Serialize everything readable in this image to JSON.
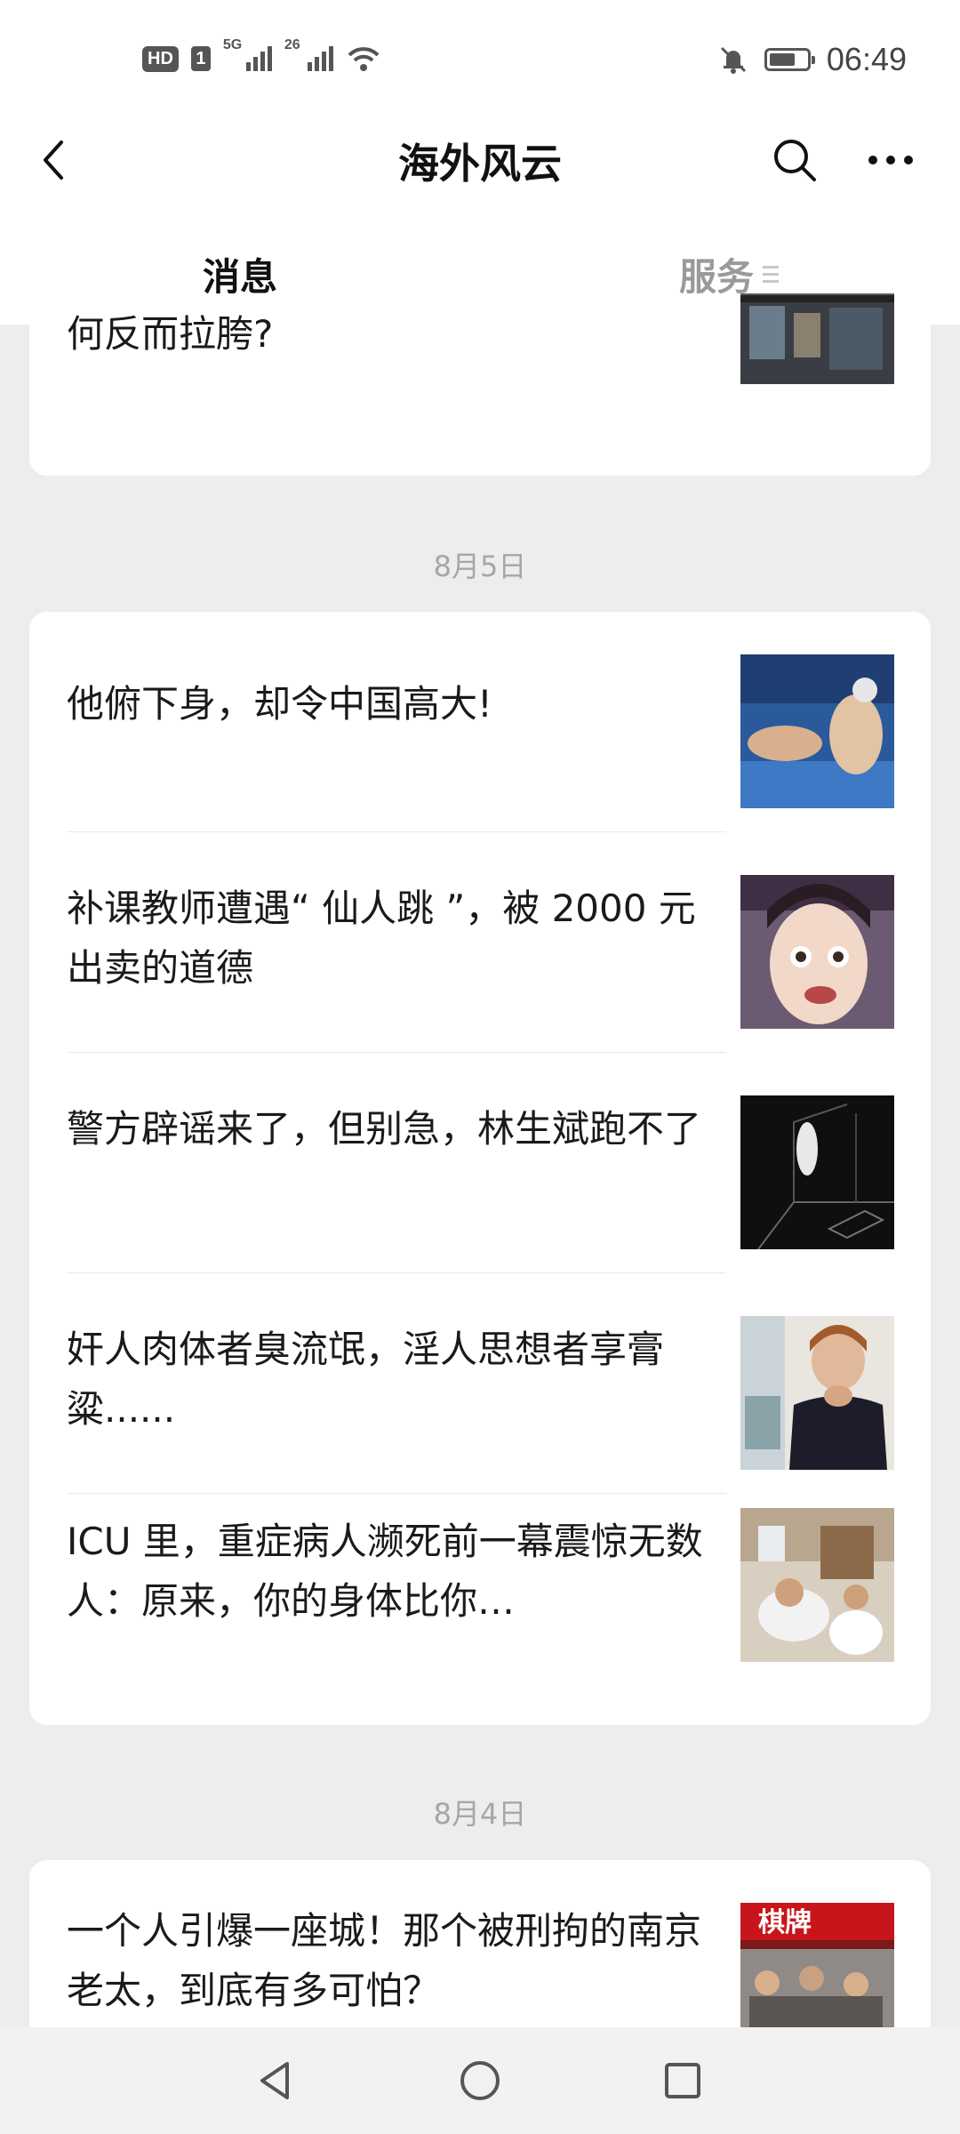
{
  "status_bar": {
    "hd_label": "HD",
    "sim_label": "1",
    "net1_label": "5G",
    "net2_label": "26",
    "time": "06:49",
    "battery_level": 0.7
  },
  "header": {
    "title": "海外风云",
    "back_icon": "back-chevron-icon",
    "search_icon": "search-icon",
    "more_icon": "more-dots-icon"
  },
  "tabs": [
    {
      "label": "消息",
      "active": true
    },
    {
      "label": "服务",
      "active": false
    }
  ],
  "top_article": {
    "title": "何反而拉胯?"
  },
  "groups": [
    {
      "date": "8月5日",
      "articles": [
        {
          "title": "他俯下身，却令中国高大!"
        },
        {
          "title": "补课教师遭遇“ 仙人跳 ”，被 2000 元出卖的道德"
        },
        {
          "title": "警方辟谣来了，但别急，林生斌跑不了"
        },
        {
          "title": "奸人肉体者臭流氓，淫人思想者享膏粱......"
        },
        {
          "title": "ICU 里，重症病人濒死前一幕震惊无数人：原来，你的身体比你…"
        }
      ]
    },
    {
      "date": "8月4日",
      "articles": [
        {
          "title": "一个人引爆一座城！那个被刑拘的南京老太，到底有多可怕？",
          "thumb_sign": "棋牌"
        }
      ]
    }
  ],
  "colors": {
    "background": "#ededed",
    "card": "#ffffff",
    "text": "#1a1a1a",
    "muted": "#a6a6a6"
  }
}
